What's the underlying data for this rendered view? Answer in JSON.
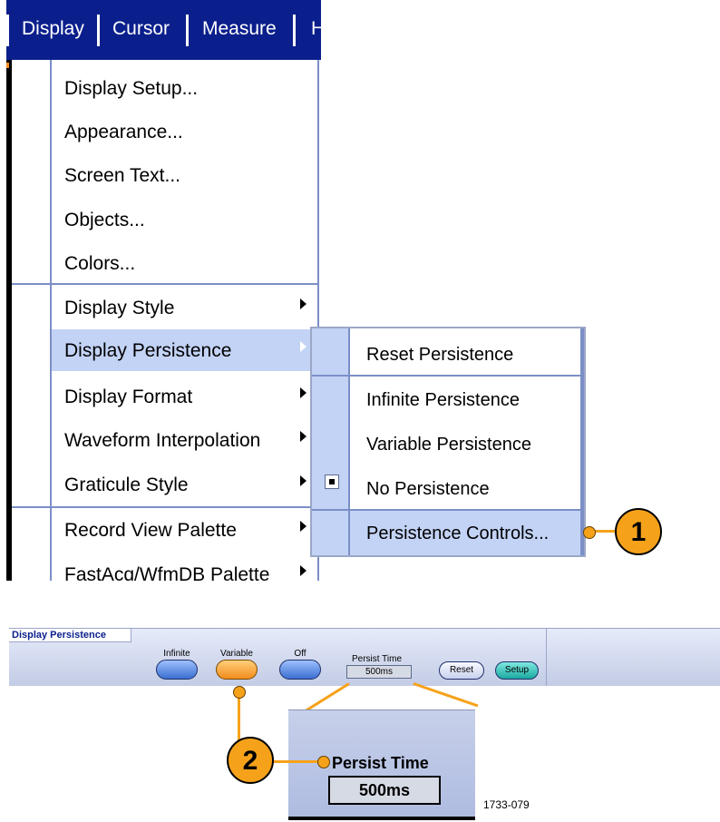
{
  "menubar": {
    "items": [
      "Display",
      "Cursor",
      "Measure",
      "H"
    ]
  },
  "display_menu": {
    "items": [
      {
        "label": "Display Setup...",
        "submenu": false
      },
      {
        "label": "Appearance...",
        "submenu": false
      },
      {
        "label": "Screen Text...",
        "submenu": false
      },
      {
        "label": "Objects...",
        "submenu": false
      },
      {
        "label": "Colors...",
        "submenu": false
      },
      {
        "label": "Display Style",
        "submenu": true
      },
      {
        "label": "Display Persistence",
        "submenu": true,
        "selected": true
      },
      {
        "label": "Display Format",
        "submenu": true
      },
      {
        "label": "Waveform Interpolation",
        "submenu": true
      },
      {
        "label": "Graticule Style",
        "submenu": true
      },
      {
        "label": "Record View Palette",
        "submenu": true
      },
      {
        "label": "FastAcq/WfmDB Palette",
        "submenu": true
      }
    ]
  },
  "persistence_submenu": {
    "items": [
      {
        "label": "Reset Persistence"
      },
      {
        "label": "Infinite Persistence"
      },
      {
        "label": "Variable Persistence"
      },
      {
        "label": "No Persistence",
        "checked": true
      },
      {
        "label": "Persistence Controls...",
        "selected": true
      }
    ]
  },
  "callouts": {
    "one": "1",
    "two": "2"
  },
  "control_panel": {
    "title": "Display Persistence",
    "buttons": [
      {
        "label": "Infinite",
        "active": false
      },
      {
        "label": "Variable",
        "active": true
      },
      {
        "label": "Off",
        "active": false
      }
    ],
    "persist_time_label": "Persist Time",
    "persist_time_value": "500ms",
    "reset_label": "Reset",
    "setup_label": "Setup"
  },
  "inset": {
    "label": "Persist Time",
    "value": "500ms"
  },
  "figure_number": "1733-079",
  "colors": {
    "menubar_bg": "#0b1f8c",
    "selection": "#c3d3f6",
    "callout": "#f5a21a",
    "active_button": "#f28c1e"
  }
}
